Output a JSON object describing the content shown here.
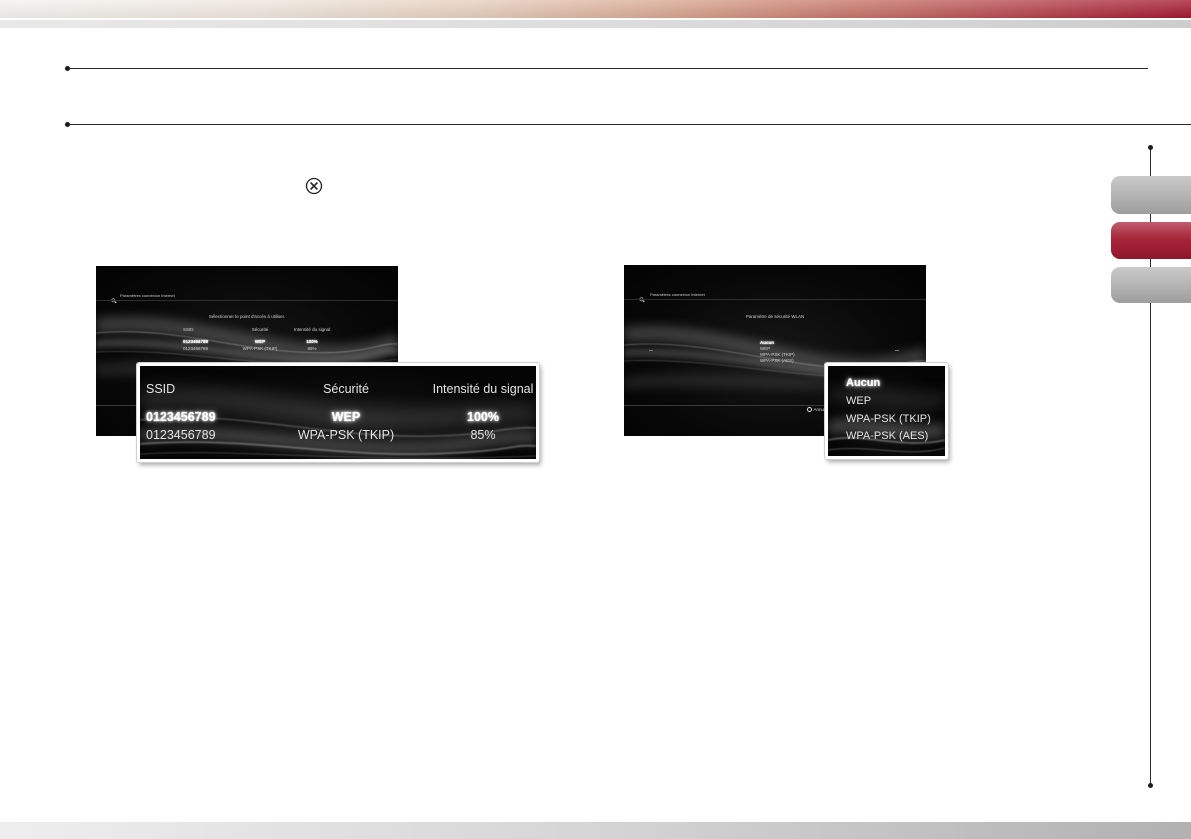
{
  "side_tabs": {
    "inactive_color": "#b3b3b3",
    "active_color": "#a3192f",
    "active_index": 1
  },
  "icons": {
    "instruction": "cross-button-icon",
    "screen_header": "network-settings-icon",
    "cancel": "circle-button-icon"
  },
  "screens": {
    "access_point": {
      "header": "Paramètres connexion Internet",
      "prompt": "Sélectionner le point d'accès à utiliser.",
      "columns": {
        "ssid": "SSID",
        "security": "Sécurité",
        "signal": "Intensité du signal"
      },
      "rows": [
        {
          "ssid": "0123456789",
          "security": "WEP",
          "signal": "100%"
        },
        {
          "ssid": "0123456789",
          "security": "WPA-PSK (TKIP)",
          "signal": "85%"
        }
      ],
      "selected_row": 0
    },
    "wlan_security": {
      "header": "Paramètres connexion Internet",
      "prompt": "Paramètre de sécurité WLAN",
      "options": [
        "Aucun",
        "WEP",
        "WPA-PSK (TKIP)",
        "WPA-PSK (AES)"
      ],
      "selected_option": 0,
      "cancel_label": "Annul"
    }
  }
}
